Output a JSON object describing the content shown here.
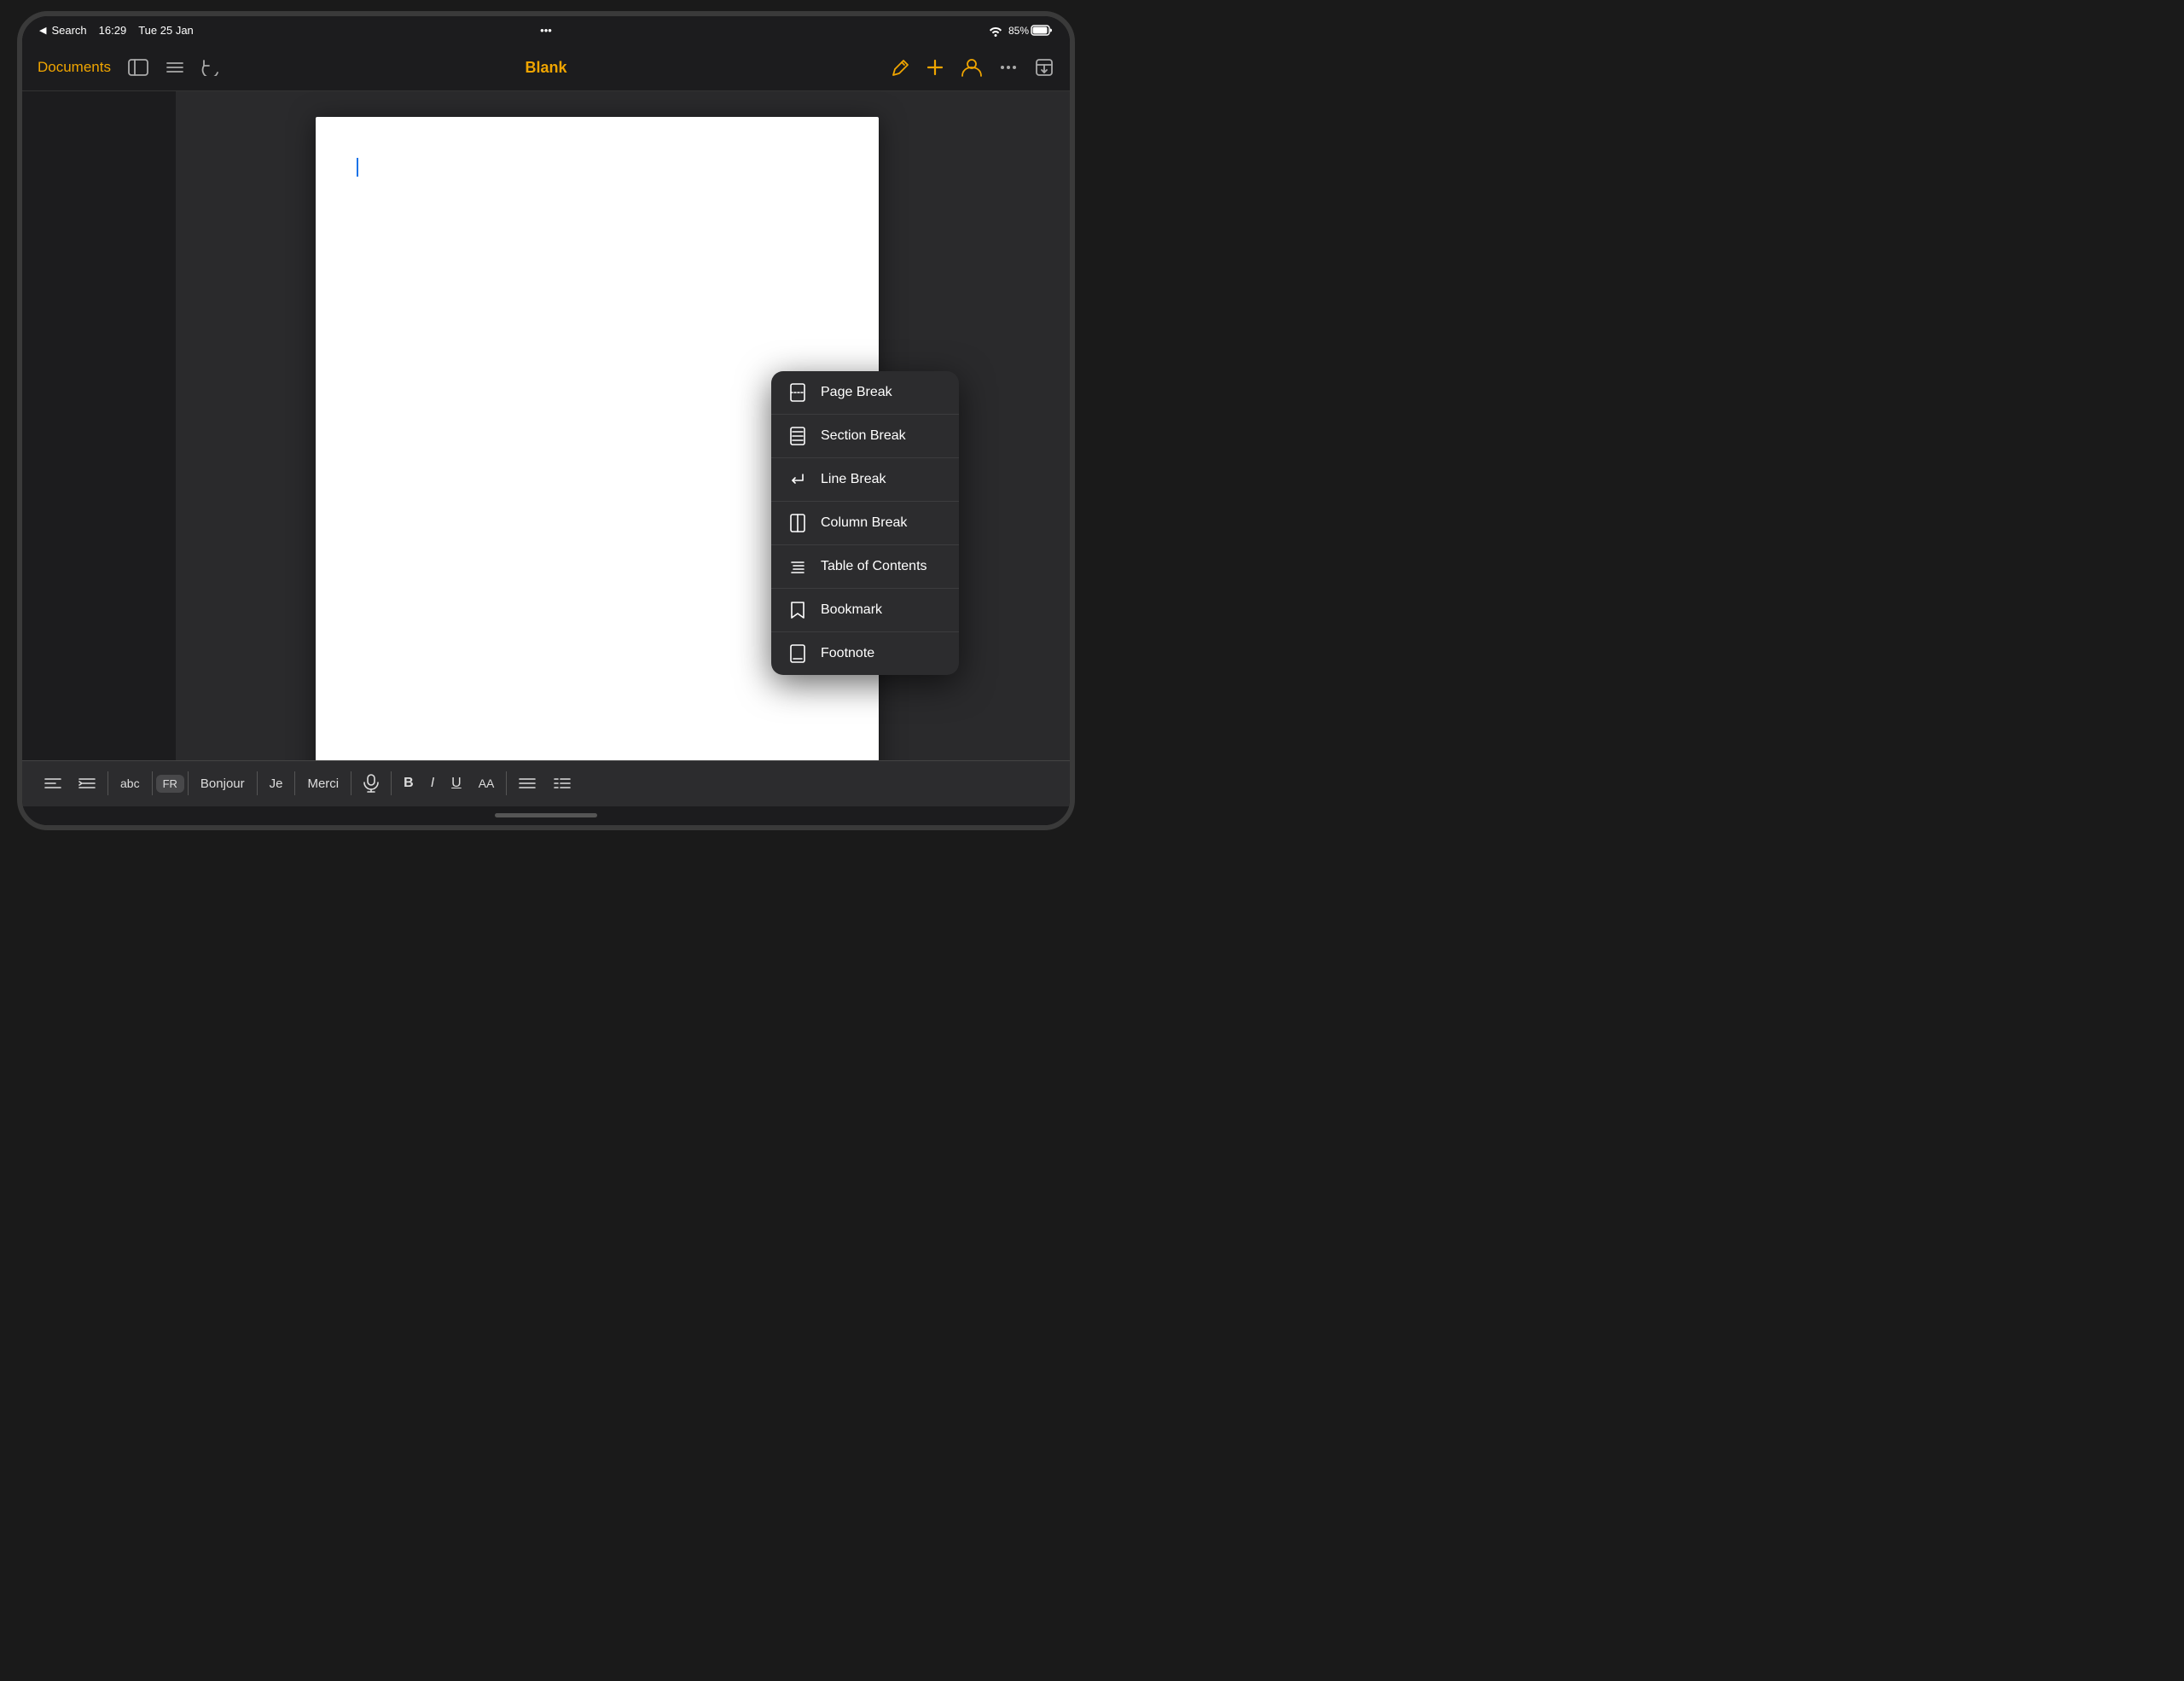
{
  "device": {
    "status_bar": {
      "back_label": "Search",
      "time": "16:29",
      "date": "Tue 25 Jan",
      "battery": "85%",
      "three_dots": "•••"
    },
    "toolbar": {
      "documents_label": "Documents",
      "title": "Blank",
      "overflow_dots": "•••"
    },
    "keyboard_bar": {
      "items": [
        "☰",
        "≡",
        "abc",
        "FR",
        "Bonjour",
        "Je",
        "Merci"
      ],
      "bold": "B",
      "italic": "I",
      "underline": "U",
      "aa": "AA"
    },
    "dropdown_menu": {
      "items": [
        {
          "id": "page-break",
          "label": "Page Break",
          "icon": "page-break-icon"
        },
        {
          "id": "section-break",
          "label": "Section Break",
          "icon": "section-break-icon"
        },
        {
          "id": "line-break",
          "label": "Line Break",
          "icon": "line-break-icon"
        },
        {
          "id": "column-break",
          "label": "Column Break",
          "icon": "column-break-icon"
        },
        {
          "id": "table-of-contents",
          "label": "Table of Contents",
          "icon": "toc-icon"
        },
        {
          "id": "bookmark",
          "label": "Bookmark",
          "icon": "bookmark-icon"
        },
        {
          "id": "footnote",
          "label": "Footnote",
          "icon": "footnote-icon"
        }
      ]
    }
  }
}
